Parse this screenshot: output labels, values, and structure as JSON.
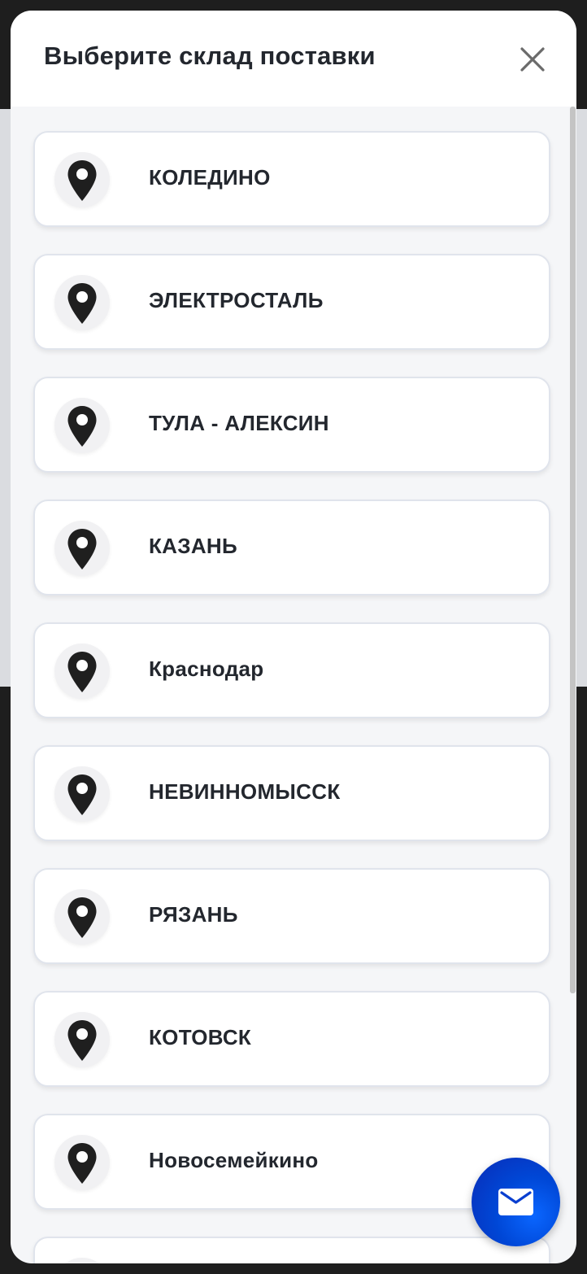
{
  "modal": {
    "title": "Выберите склад поставки"
  },
  "warehouses": [
    {
      "label": "КОЛЕДИНО"
    },
    {
      "label": "ЭЛЕКТРОСТАЛЬ"
    },
    {
      "label": "ТУЛА - АЛЕКСИН"
    },
    {
      "label": "КАЗАНЬ"
    },
    {
      "label": "Краснодар"
    },
    {
      "label": "НЕВИННОМЫССК"
    },
    {
      "label": "РЯЗАНЬ"
    },
    {
      "label": "КОТОВСК"
    },
    {
      "label": "Новосемейкино"
    },
    {
      "label": ""
    }
  ],
  "icons": {
    "close": "close-icon",
    "pin": "map-pin-icon",
    "mail": "mail-icon"
  },
  "colors": {
    "accent": "#0047d6",
    "text": "#23272e",
    "card_border": "#e0e4ec"
  }
}
